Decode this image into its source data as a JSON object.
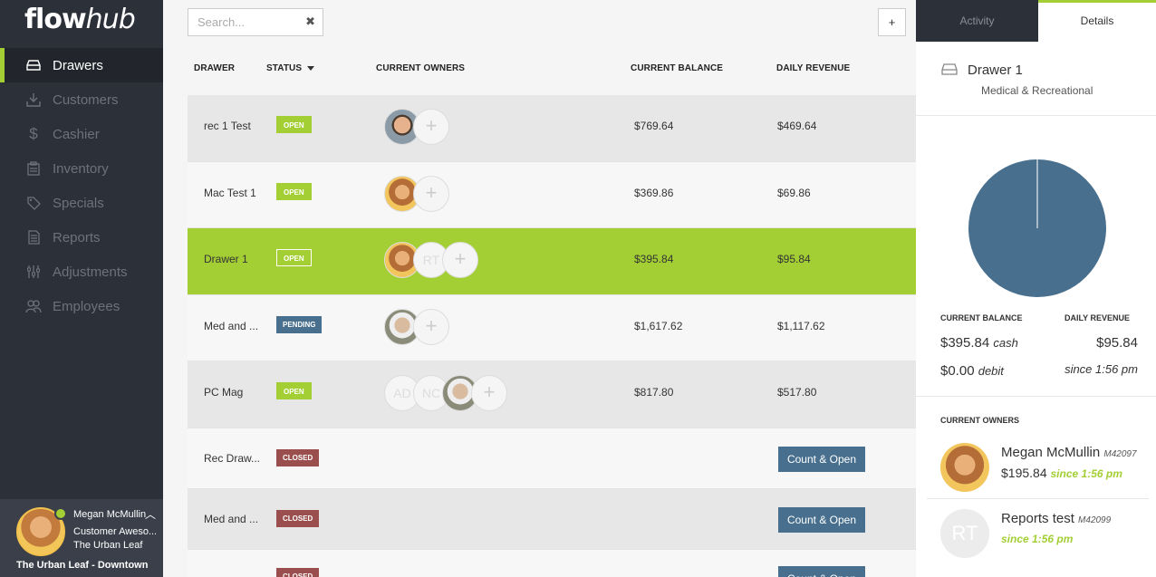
{
  "app": {
    "logo_bold": "flow",
    "logo_italic": "hub"
  },
  "sidebar": {
    "items": [
      {
        "label": "Drawers",
        "icon": "drawer-icon",
        "active": true
      },
      {
        "label": "Customers",
        "icon": "download-icon"
      },
      {
        "label": "Cashier",
        "icon": "dollar-icon"
      },
      {
        "label": "Inventory",
        "icon": "inventory-icon"
      },
      {
        "label": "Specials",
        "icon": "tag-icon"
      },
      {
        "label": "Reports",
        "icon": "report-icon"
      },
      {
        "label": "Adjustments",
        "icon": "sliders-icon"
      },
      {
        "label": "Employees",
        "icon": "people-icon"
      }
    ],
    "user": {
      "name": "Megan McMullin",
      "role": "Customer Aweso...",
      "store": "The Urban Leaf",
      "location": "The Urban Leaf - Downtown"
    }
  },
  "toolbar": {
    "search_placeholder": "Search...",
    "clear_glyph": "✖",
    "add_glyph": "+"
  },
  "table": {
    "headers": {
      "drawer": "DRAWER",
      "status": "STATUS",
      "owners": "CURRENT OWNERS",
      "balance": "CURRENT BALANCE",
      "revenue": "DAILY REVENUE"
    },
    "rows": [
      {
        "name": "rec 1 Test",
        "status": "OPEN",
        "balance": "$769.64",
        "revenue": "$469.64"
      },
      {
        "name": "Mac Test 1",
        "status": "OPEN",
        "balance": "$369.86",
        "revenue": "$69.86"
      },
      {
        "name": "Drawer 1",
        "status": "OPEN",
        "balance": "$395.84",
        "revenue": "$95.84",
        "owner_initials": "RT"
      },
      {
        "name": "Med and ...",
        "status": "PENDING",
        "balance": "$1,617.62",
        "revenue": "$1,117.62"
      },
      {
        "name": "PC Mag",
        "status": "OPEN",
        "balance": "$817.80",
        "revenue": "$517.80",
        "owner_initials_1": "AD",
        "owner_initials_2": "NC"
      },
      {
        "name": "Rec Draw...",
        "status": "CLOSED",
        "action": "Count & Open"
      },
      {
        "name": "Med and ...",
        "status": "CLOSED",
        "action": "Count & Open"
      },
      {
        "status": "CLOSED",
        "action": "Count & Open"
      }
    ]
  },
  "panel": {
    "tabs": [
      {
        "label": "Activity"
      },
      {
        "label": "Details"
      }
    ],
    "drawer_title": "Drawer 1",
    "drawer_subtitle": "Medical & Recreational",
    "chart": {
      "cash_fraction": 1.0,
      "color": "#48708e"
    },
    "balance_label": "CURRENT BALANCE",
    "revenue_label": "DAILY REVENUE",
    "cash_value": "$395.84",
    "cash_word": "cash",
    "revenue_value": "$95.84",
    "debit_value": "$0.00",
    "debit_word": "debit",
    "since": "since 1:56 pm",
    "owners_label": "CURRENT OWNERS",
    "owners": [
      {
        "name": "Megan McMullin",
        "id": "M42097",
        "amount": "$195.84",
        "since": "since 1:56 pm"
      },
      {
        "name": "Reports test",
        "id": "M42099",
        "initials": "RT",
        "since": "since 1:56 pm"
      }
    ]
  },
  "colors": {
    "accent": "#a3cf35",
    "sidebar": "#2c3039",
    "pending": "#48708e",
    "closed": "#9b4e4e"
  }
}
